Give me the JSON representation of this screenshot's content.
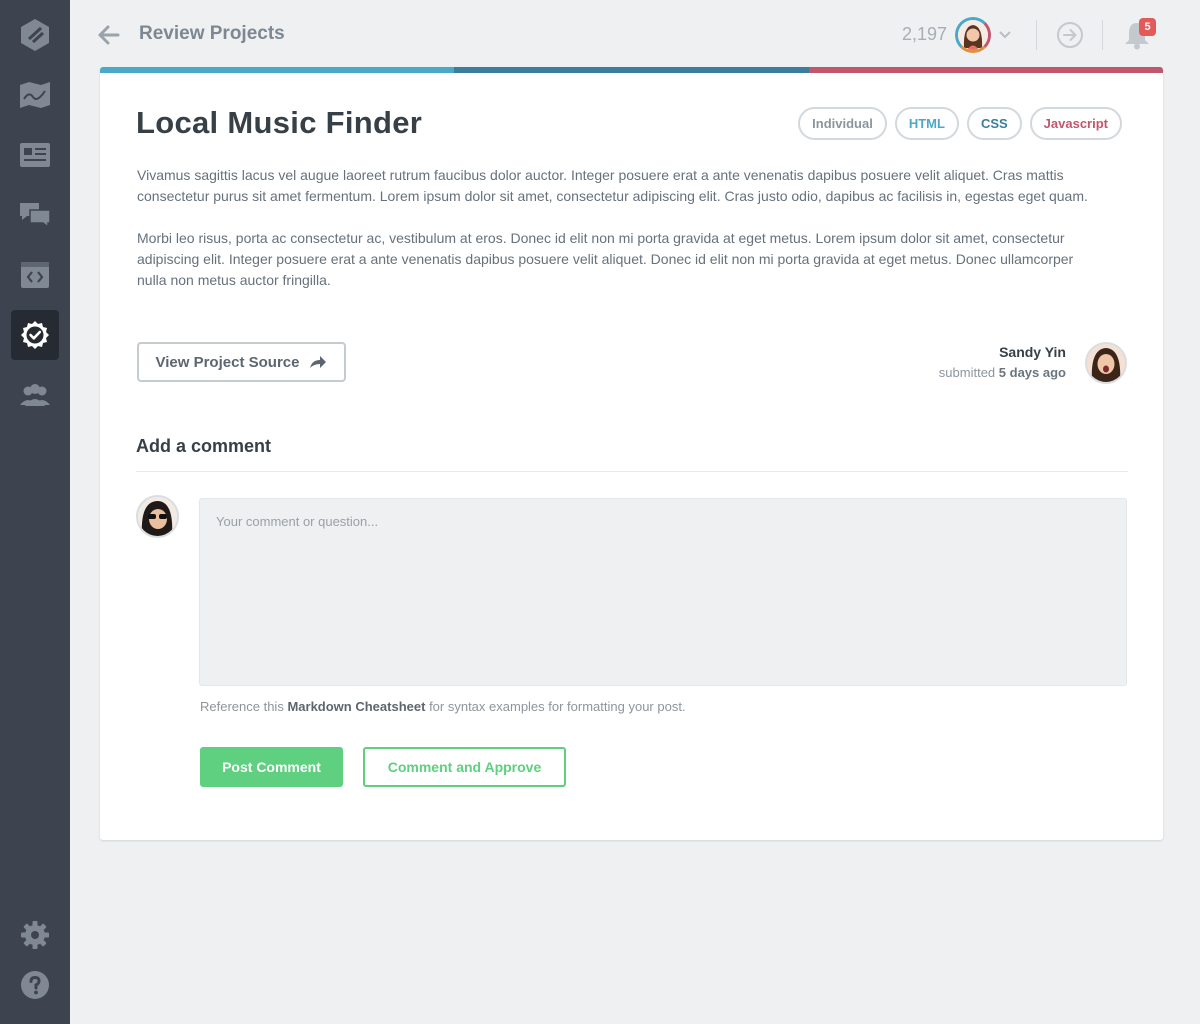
{
  "sidebar": {
    "items": [
      {
        "icon": "treehouse-logo-icon",
        "active": false
      },
      {
        "icon": "map-icon",
        "active": false
      },
      {
        "icon": "library-icon",
        "active": false
      },
      {
        "icon": "forum-icon",
        "active": false
      },
      {
        "icon": "workspace-icon",
        "active": false
      },
      {
        "icon": "review-check-icon",
        "active": true
      },
      {
        "icon": "community-icon",
        "active": false
      }
    ],
    "bottom": [
      {
        "icon": "settings-gear-icon"
      },
      {
        "icon": "help-question-icon"
      }
    ]
  },
  "header": {
    "title": "Review Projects",
    "points": "2,197",
    "notification_count": "5"
  },
  "project": {
    "title": "Local Music Finder",
    "progress_colors": [
      "#4aa9c7",
      "#3a7d9c",
      "#c2566e"
    ],
    "tags": [
      {
        "label": "Individual",
        "color": "#8d959c"
      },
      {
        "label": "HTML",
        "color": "#4aa9c7"
      },
      {
        "label": "CSS",
        "color": "#3a7d9c"
      },
      {
        "label": "Javascript",
        "color": "#c2566e"
      }
    ],
    "description": [
      "Vivamus sagittis lacus vel augue laoreet rutrum faucibus dolor auctor. Integer posuere erat a ante venenatis dapibus posuere velit aliquet. Cras mattis consectetur purus sit amet fermentum. Lorem ipsum dolor sit amet, consectetur adipiscing elit. Cras justo odio, dapibus ac facilisis in, egestas eget quam.",
      "Morbi leo risus, porta ac consectetur ac, vestibulum at eros. Donec id elit non mi porta gravida at eget metus. Lorem ipsum dolor sit amet, consectetur adipiscing elit. Integer posuere erat a ante venenatis dapibus posuere velit aliquet. Donec id elit non mi porta gravida at eget metus. Donec ullamcorper nulla non metus auctor fringilla."
    ],
    "source_button": "View Project Source",
    "author": {
      "name": "Sandy Yin",
      "submitted_prefix": "submitted",
      "submitted_when": "5 days ago"
    }
  },
  "comment": {
    "heading": "Add a comment",
    "placeholder": "Your comment or question...",
    "helper_prefix": "Reference this",
    "helper_link": "Markdown Cheatsheet",
    "helper_suffix": "for syntax examples for formatting your post.",
    "post_button": "Post Comment",
    "approve_button": "Comment and Approve"
  },
  "colors": {
    "sidebar_bg": "#3d444f",
    "accent_green": "#5fcf80",
    "badge_red": "#e25a5a"
  }
}
